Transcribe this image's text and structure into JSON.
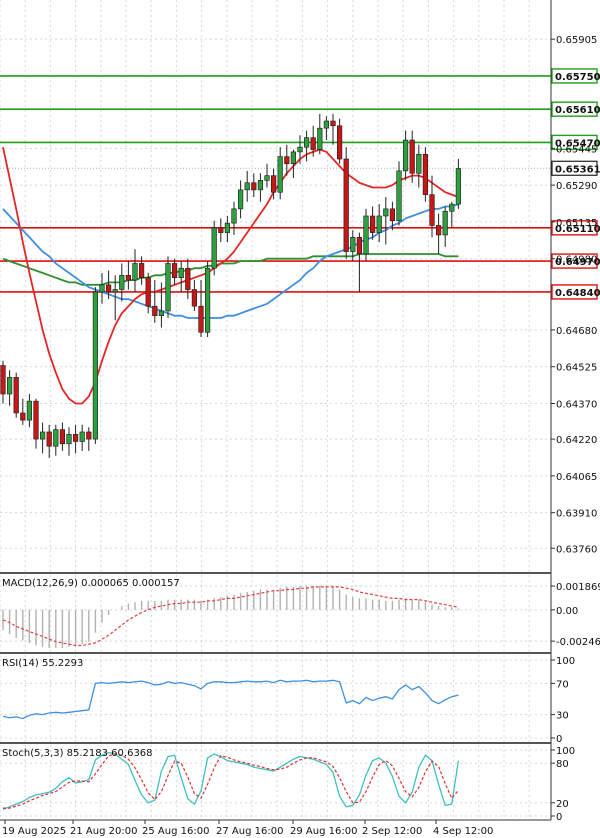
{
  "chart_data": {
    "type": "candlestick",
    "main_panel": {
      "y_ticks": [
        "0.65905",
        "0.65445",
        "0.65290",
        "0.65135",
        "0.64980",
        "0.64680",
        "0.64525",
        "0.64370",
        "0.64220",
        "0.64065",
        "0.63910",
        "0.63760"
      ],
      "ylim": [
        0.6366,
        0.6607
      ],
      "current_price": "0.65361",
      "horizontal_levels": [
        {
          "value": "0.65750",
          "price": 0.6575,
          "color": "#1f9e1f"
        },
        {
          "value": "0.65610",
          "price": 0.6561,
          "color": "#1f9e1f"
        },
        {
          "value": "0.65470",
          "price": 0.6547,
          "color": "#1f9e1f"
        },
        {
          "value": "0.65110",
          "price": 0.6511,
          "color": "#e01010"
        },
        {
          "value": "0.64970",
          "price": 0.6497,
          "color": "#e01010"
        },
        {
          "value": "0.64840",
          "price": 0.6484,
          "color": "#e01010"
        }
      ],
      "candles": [
        [
          0.6453,
          0.6455,
          0.6437,
          0.6441
        ],
        [
          0.6441,
          0.6451,
          0.6436,
          0.6448
        ],
        [
          0.6448,
          0.645,
          0.6431,
          0.6433
        ],
        [
          0.6433,
          0.6439,
          0.6428,
          0.643
        ],
        [
          0.643,
          0.6441,
          0.6427,
          0.6438
        ],
        [
          0.6438,
          0.6439,
          0.6418,
          0.6422
        ],
        [
          0.6422,
          0.6429,
          0.6416,
          0.6425
        ],
        [
          0.6425,
          0.6428,
          0.6414,
          0.6419
        ],
        [
          0.6419,
          0.6428,
          0.6415,
          0.6426
        ],
        [
          0.6426,
          0.6429,
          0.6417,
          0.642
        ],
        [
          0.642,
          0.6427,
          0.6415,
          0.6424
        ],
        [
          0.6424,
          0.6428,
          0.6416,
          0.6421
        ],
        [
          0.6421,
          0.6428,
          0.6417,
          0.6425
        ],
        [
          0.6425,
          0.6427,
          0.6417,
          0.6422
        ],
        [
          0.6422,
          0.6486,
          0.642,
          0.6484
        ],
        [
          0.6484,
          0.6492,
          0.6479,
          0.6487
        ],
        [
          0.6487,
          0.6493,
          0.6481,
          0.6484
        ],
        [
          0.6484,
          0.6491,
          0.6472,
          0.6485
        ],
        [
          0.6485,
          0.6496,
          0.648,
          0.6491
        ],
        [
          0.6491,
          0.6497,
          0.6485,
          0.6489
        ],
        [
          0.6489,
          0.6502,
          0.6484,
          0.6496
        ],
        [
          0.6496,
          0.6499,
          0.6487,
          0.649
        ],
        [
          0.649,
          0.6492,
          0.6475,
          0.6478
        ],
        [
          0.6478,
          0.6489,
          0.6471,
          0.6474
        ],
        [
          0.6474,
          0.6488,
          0.6469,
          0.6476
        ],
        [
          0.6476,
          0.6499,
          0.6473,
          0.6496
        ],
        [
          0.6496,
          0.6498,
          0.6487,
          0.649
        ],
        [
          0.649,
          0.6497,
          0.6484,
          0.6494
        ],
        [
          0.6494,
          0.6498,
          0.6481,
          0.6485
        ],
        [
          0.6485,
          0.6489,
          0.6476,
          0.6478
        ],
        [
          0.6478,
          0.6489,
          0.6465,
          0.6467
        ],
        [
          0.6467,
          0.6497,
          0.6465,
          0.6494
        ],
        [
          0.6494,
          0.6514,
          0.6491,
          0.6511
        ],
        [
          0.6511,
          0.6515,
          0.6505,
          0.6509
        ],
        [
          0.6509,
          0.6516,
          0.6505,
          0.6513
        ],
        [
          0.6513,
          0.6522,
          0.6508,
          0.6519
        ],
        [
          0.6519,
          0.6531,
          0.6515,
          0.6527
        ],
        [
          0.6527,
          0.6535,
          0.6522,
          0.653
        ],
        [
          0.653,
          0.6534,
          0.6524,
          0.6527
        ],
        [
          0.6527,
          0.6534,
          0.6522,
          0.6531
        ],
        [
          0.6531,
          0.6538,
          0.6528,
          0.6533
        ],
        [
          0.6533,
          0.6536,
          0.6523,
          0.6526
        ],
        [
          0.6526,
          0.6545,
          0.6523,
          0.6541
        ],
        [
          0.6541,
          0.6546,
          0.6533,
          0.6538
        ],
        [
          0.6538,
          0.6544,
          0.6532,
          0.6543
        ],
        [
          0.6543,
          0.655,
          0.6538,
          0.6545
        ],
        [
          0.6545,
          0.6552,
          0.6539,
          0.6549
        ],
        [
          0.6549,
          0.6554,
          0.6541,
          0.6544
        ],
        [
          0.6544,
          0.6559,
          0.6542,
          0.6553
        ],
        [
          0.6553,
          0.6558,
          0.6548,
          0.6556
        ],
        [
          0.6556,
          0.6559,
          0.6546,
          0.6554
        ],
        [
          0.6554,
          0.6557,
          0.6538,
          0.654
        ],
        [
          0.654,
          0.6545,
          0.6498,
          0.6501
        ],
        [
          0.6501,
          0.651,
          0.6497,
          0.6507
        ],
        [
          0.6507,
          0.6509,
          0.6484,
          0.65
        ],
        [
          0.65,
          0.6519,
          0.6497,
          0.6516
        ],
        [
          0.6516,
          0.652,
          0.6506,
          0.6509
        ],
        [
          0.6509,
          0.6521,
          0.6505,
          0.6516
        ],
        [
          0.6516,
          0.6524,
          0.6504,
          0.6519
        ],
        [
          0.6519,
          0.6522,
          0.651,
          0.6514
        ],
        [
          0.6514,
          0.6539,
          0.6512,
          0.6535
        ],
        [
          0.6535,
          0.6552,
          0.6531,
          0.6548
        ],
        [
          0.6548,
          0.6552,
          0.653,
          0.6534
        ],
        [
          0.6534,
          0.6546,
          0.6528,
          0.6542
        ],
        [
          0.6542,
          0.6545,
          0.6522,
          0.6525
        ],
        [
          0.6525,
          0.6533,
          0.6507,
          0.6512
        ],
        [
          0.6512,
          0.6517,
          0.65,
          0.6508
        ],
        [
          0.6508,
          0.652,
          0.6503,
          0.6518
        ],
        [
          0.6518,
          0.6522,
          0.6511,
          0.6521
        ],
        [
          0.6521,
          0.654,
          0.6519,
          0.6536
        ]
      ],
      "ma_red": [
        0.6545,
        0.6532,
        0.6519,
        0.6505,
        0.6492,
        0.648,
        0.6468,
        0.6458,
        0.645,
        0.6443,
        0.6439,
        0.6437,
        0.6437,
        0.644,
        0.6446,
        0.6455,
        0.6463,
        0.647,
        0.6475,
        0.6478,
        0.6481,
        0.6483,
        0.6484,
        0.6484,
        0.6485,
        0.6486,
        0.6487,
        0.6488,
        0.6489,
        0.649,
        0.6491,
        0.6492,
        0.6494,
        0.6496,
        0.6498,
        0.6501,
        0.6505,
        0.6509,
        0.6513,
        0.6517,
        0.6521,
        0.6526,
        0.653,
        0.6534,
        0.6537,
        0.654,
        0.6542,
        0.6543,
        0.6544,
        0.6543,
        0.654,
        0.6537,
        0.6534,
        0.6532,
        0.653,
        0.6529,
        0.6528,
        0.6528,
        0.6528,
        0.6529,
        0.6531,
        0.6532,
        0.6533,
        0.6533,
        0.6532,
        0.653,
        0.6528,
        0.6526,
        0.6525,
        0.6524
      ],
      "ma_blue": [
        0.6519,
        0.6516,
        0.6513,
        0.651,
        0.6507,
        0.6504,
        0.6501,
        0.6499,
        0.6496,
        0.6494,
        0.6492,
        0.649,
        0.6488,
        0.6486,
        0.6485,
        0.6484,
        0.6483,
        0.6482,
        0.6481,
        0.6481,
        0.648,
        0.6479,
        0.6478,
        0.6477,
        0.6476,
        0.6475,
        0.6474,
        0.6474,
        0.6473,
        0.6473,
        0.6473,
        0.6473,
        0.6473,
        0.6473,
        0.6474,
        0.6474,
        0.6475,
        0.6476,
        0.6477,
        0.6478,
        0.6479,
        0.6481,
        0.6483,
        0.6485,
        0.6487,
        0.6489,
        0.6492,
        0.6494,
        0.6497,
        0.6499,
        0.65,
        0.6501,
        0.6502,
        0.6503,
        0.6505,
        0.6506,
        0.6507,
        0.6509,
        0.651,
        0.6512,
        0.6513,
        0.6515,
        0.6516,
        0.6517,
        0.6518,
        0.6519,
        0.6519,
        0.652,
        0.652,
        0.6521
      ],
      "ma_green": [
        0.6498,
        0.6497,
        0.6496,
        0.6495,
        0.6494,
        0.6493,
        0.6492,
        0.6491,
        0.649,
        0.6489,
        0.6488,
        0.6488,
        0.6487,
        0.6487,
        0.6487,
        0.6487,
        0.6488,
        0.6488,
        0.6488,
        0.6489,
        0.6489,
        0.649,
        0.649,
        0.6491,
        0.6491,
        0.6492,
        0.6492,
        0.6493,
        0.6493,
        0.6494,
        0.6494,
        0.6495,
        0.6495,
        0.6496,
        0.6496,
        0.6496,
        0.6497,
        0.6497,
        0.6497,
        0.6497,
        0.6498,
        0.6498,
        0.6498,
        0.6498,
        0.6498,
        0.6498,
        0.6498,
        0.6499,
        0.6499,
        0.6499,
        0.6499,
        0.6499,
        0.6499,
        0.6499,
        0.65,
        0.65,
        0.65,
        0.65,
        0.65,
        0.65,
        0.65,
        0.65,
        0.65,
        0.65,
        0.65,
        0.65,
        0.65,
        0.6499,
        0.6499,
        0.6499
      ]
    },
    "macd_panel": {
      "label": "MACD(12,26,9) 0.000065 0.000157",
      "y_ticks": [
        "0.001869",
        "0.00",
        "-0.002461"
      ],
      "ylim": [
        -0.003,
        0.0025
      ],
      "histogram": [
        -0.0016,
        -0.0019,
        -0.0022,
        -0.0024,
        -0.0026,
        -0.0028,
        -0.0029,
        -0.003,
        -0.003,
        -0.003,
        -0.0029,
        -0.0028,
        -0.0027,
        -0.0025,
        -0.0018,
        -0.001,
        -0.0004,
        0.0,
        0.0003,
        0.0005,
        0.0006,
        0.0007,
        0.0007,
        0.0007,
        0.0007,
        0.0008,
        0.0008,
        0.0008,
        0.0008,
        0.0008,
        0.0007,
        0.0008,
        0.0009,
        0.001,
        0.0011,
        0.0012,
        0.0013,
        0.0014,
        0.0015,
        0.0016,
        0.0016,
        0.0016,
        0.0017,
        0.0018,
        0.0018,
        0.0019,
        0.0019,
        0.0019,
        0.0019,
        0.0019,
        0.0019,
        0.0016,
        0.0012,
        0.001,
        0.0009,
        0.0009,
        0.0008,
        0.0008,
        0.0007,
        0.0007,
        0.0008,
        0.0009,
        0.0008,
        0.0008,
        0.0006,
        0.0004,
        0.0003,
        0.0002,
        0.0002,
        0.0001
      ],
      "signal": [
        -0.0008,
        -0.001,
        -0.0013,
        -0.0015,
        -0.0017,
        -0.0019,
        -0.0021,
        -0.0023,
        -0.0025,
        -0.0026,
        -0.0027,
        -0.0028,
        -0.0028,
        -0.0027,
        -0.0026,
        -0.0023,
        -0.002,
        -0.0016,
        -0.0012,
        -0.0008,
        -0.0005,
        -0.0002,
        0.0,
        0.0002,
        0.0003,
        0.0004,
        0.0005,
        0.0005,
        0.0006,
        0.0006,
        0.0006,
        0.0007,
        0.0007,
        0.0008,
        0.0009,
        0.0009,
        0.001,
        0.0011,
        0.0012,
        0.0013,
        0.0014,
        0.0015,
        0.0015,
        0.0016,
        0.0016,
        0.0017,
        0.0017,
        0.0018,
        0.0018,
        0.0018,
        0.0018,
        0.0018,
        0.0017,
        0.0016,
        0.0014,
        0.0013,
        0.0012,
        0.0011,
        0.001,
        0.0009,
        0.0009,
        0.0008,
        0.0008,
        0.0008,
        0.0007,
        0.0006,
        0.0005,
        0.0004,
        0.0003,
        0.0002
      ]
    },
    "rsi_panel": {
      "label": "RSI(14) 55.2293",
      "y_ticks": [
        "100",
        "70",
        "30",
        "0"
      ],
      "ylim": [
        0,
        100
      ],
      "values": [
        28,
        26,
        27,
        25,
        29,
        31,
        30,
        32,
        33,
        32,
        33,
        34,
        35,
        36,
        70,
        71,
        70,
        71,
        72,
        71,
        72,
        73,
        71,
        68,
        69,
        72,
        70,
        71,
        69,
        67,
        63,
        70,
        72,
        72,
        71,
        71,
        72,
        73,
        72,
        72,
        73,
        71,
        74,
        72,
        73,
        73,
        74,
        72,
        73,
        73,
        74,
        72,
        45,
        48,
        44,
        52,
        48,
        51,
        53,
        50,
        62,
        68,
        62,
        66,
        58,
        48,
        44,
        49,
        53,
        55
      ]
    },
    "stoch_panel": {
      "label": "Stoch(5,3,3) 85.2183 60.6368",
      "y_ticks": [
        "100",
        "80",
        "20",
        "0"
      ],
      "ylim": [
        0,
        100
      ],
      "k": [
        10,
        14,
        18,
        22,
        28,
        32,
        34,
        36,
        42,
        52,
        58,
        50,
        52,
        55,
        85,
        92,
        96,
        94,
        86,
        78,
        54,
        32,
        20,
        24,
        68,
        90,
        92,
        58,
        26,
        18,
        38,
        88,
        94,
        90,
        84,
        82,
        80,
        78,
        74,
        72,
        70,
        68,
        74,
        80,
        86,
        90,
        88,
        86,
        82,
        78,
        66,
        30,
        14,
        16,
        32,
        62,
        84,
        88,
        80,
        60,
        30,
        20,
        36,
        74,
        92,
        84,
        48,
        16,
        18,
        84
      ],
      "d": [
        12,
        12,
        15,
        18,
        23,
        27,
        31,
        34,
        37,
        44,
        51,
        53,
        53,
        52,
        64,
        78,
        91,
        94,
        92,
        86,
        73,
        55,
        35,
        25,
        37,
        61,
        83,
        80,
        59,
        34,
        27,
        48,
        73,
        91,
        89,
        85,
        82,
        80,
        77,
        75,
        72,
        70,
        71,
        74,
        80,
        85,
        88,
        88,
        85,
        82,
        75,
        58,
        37,
        20,
        21,
        37,
        59,
        78,
        84,
        76,
        57,
        37,
        29,
        43,
        67,
        83,
        75,
        49,
        27,
        39
      ]
    },
    "x_labels": [
      "19 Aug 2025",
      "21 Aug 20:00",
      "25 Aug 16:00",
      "27 Aug 16:00",
      "29 Aug 16:00",
      "2 Sep 12:00",
      "4 Sep 12:00"
    ],
    "colors": {
      "bull_body": "#2e9e3e",
      "bear_body": "#c41818",
      "wick": "#222222",
      "ma_red": "#e32727",
      "ma_blue": "#3d8fe0",
      "ma_green": "#2f8f2f",
      "macd_hist": "#b0b0b0",
      "macd_signal": "#e04040",
      "rsi_line": "#3d8fe0",
      "stoch_k": "#3fbfbf",
      "stoch_d": "#e03030",
      "grid": "#cfd8e3",
      "separator": "#555555"
    }
  }
}
